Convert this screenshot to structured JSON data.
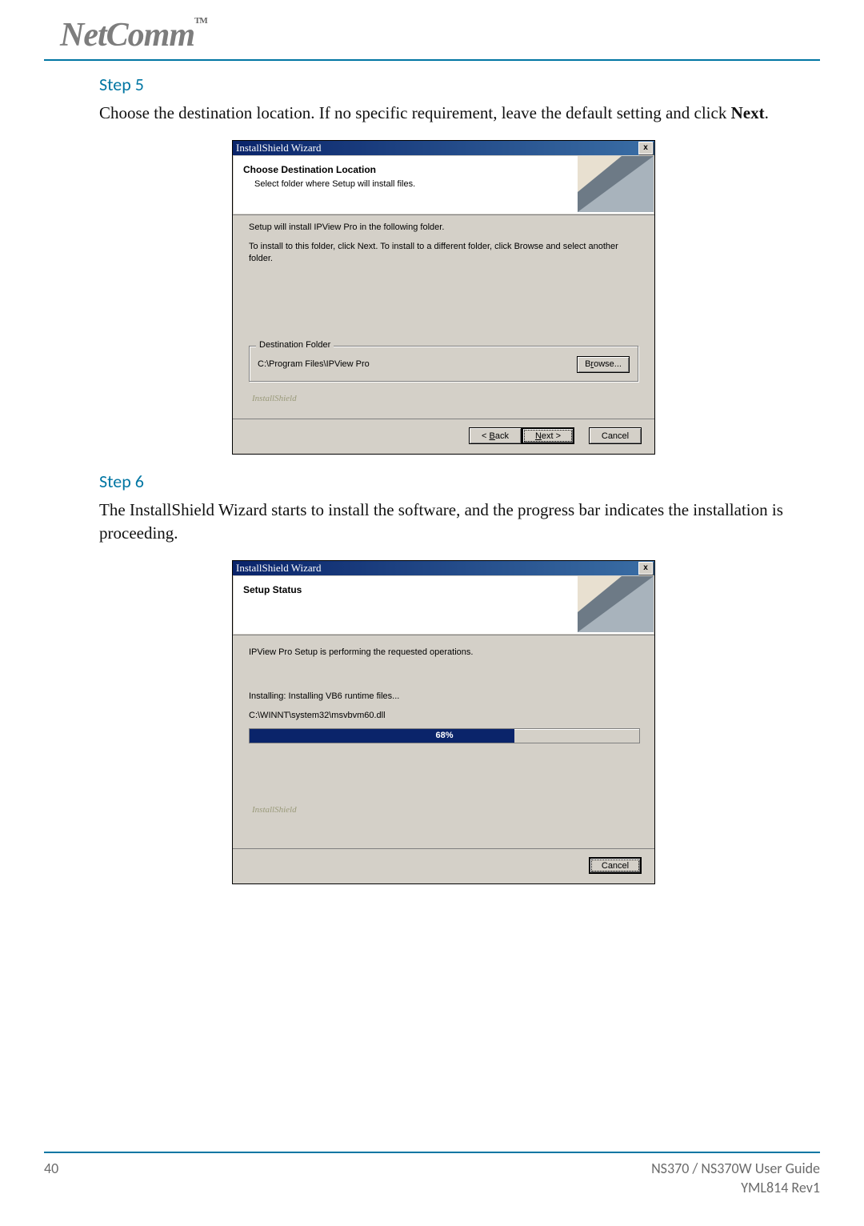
{
  "header": {
    "logo": "NetComm",
    "tm": "TM"
  },
  "step5": {
    "title": "Step 5",
    "text_part1": "Choose the destination location.  If no specific requirement, leave the default setting and click ",
    "text_bold": "Next",
    "text_part2": "."
  },
  "dialog1": {
    "title": "InstallShield Wizard",
    "close": "x",
    "panel_title": "Choose Destination Location",
    "panel_sub": "Select folder where Setup will install files.",
    "body1": "Setup will install IPView Pro in the following folder.",
    "body2": "To install to this folder, click Next. To install to a different folder, click Browse and select another folder.",
    "group_title": "Destination Folder",
    "path": "C:\\Program Files\\IPView Pro",
    "browse": "Browse...",
    "install_label": "InstallShield",
    "back": "< Back",
    "next": "Next >",
    "cancel": "Cancel"
  },
  "step6": {
    "title": "Step 6",
    "text": "The InstallShield Wizard starts to install the software, and the progress bar indicates the installation is proceeding."
  },
  "dialog2": {
    "title": "InstallShield Wizard",
    "close": "x",
    "panel_title": "Setup Status",
    "body1": "IPView Pro Setup is performing the requested operations.",
    "installing": "Installing: Installing VB6 runtime files...",
    "file": "C:\\WINNT\\system32\\msvbvm60.dll",
    "percent": "68%",
    "install_label": "InstallShield",
    "cancel": "Cancel"
  },
  "footer": {
    "page": "40",
    "guide": "NS370 / NS370W User Guide",
    "rev": "YML814 Rev1"
  }
}
